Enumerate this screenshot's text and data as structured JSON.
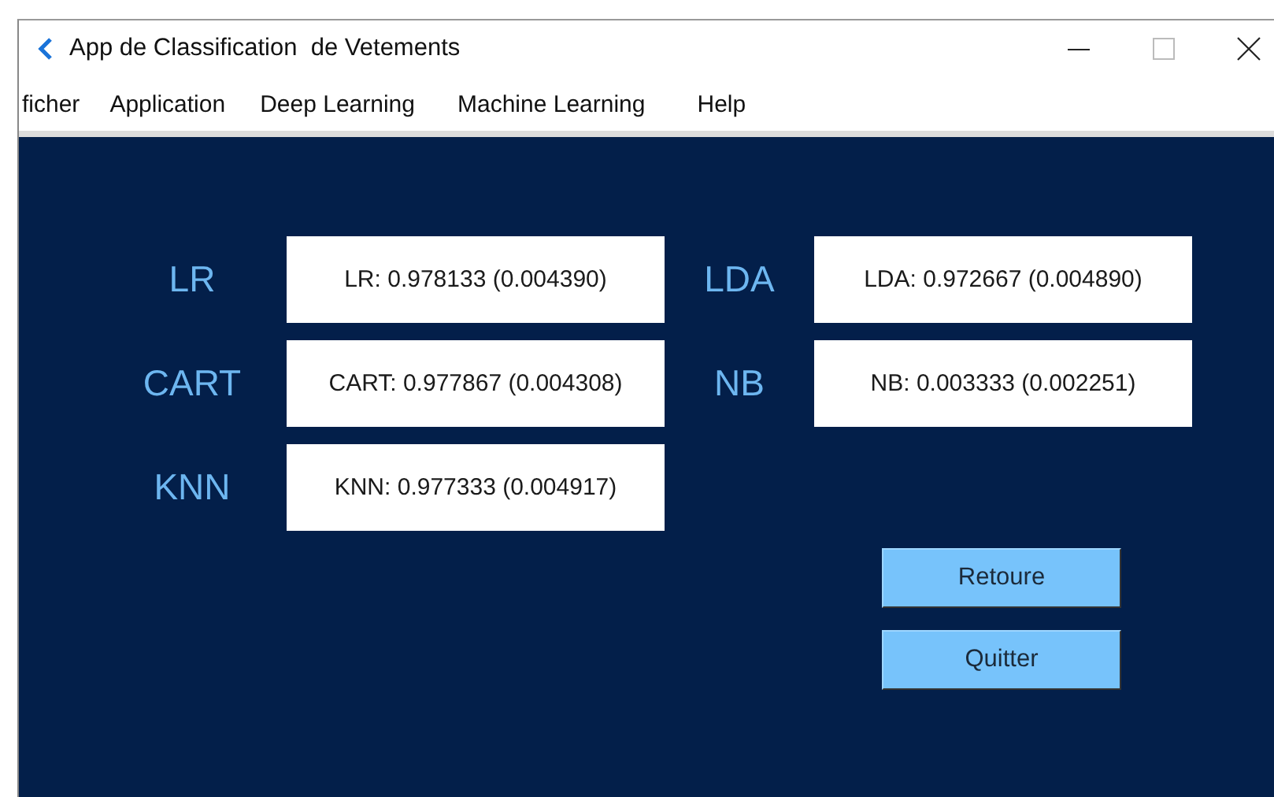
{
  "window": {
    "title": "App de Classification  de Vetements"
  },
  "menu": [
    "ficher",
    "Application",
    "Deep Learning",
    "Machine Learning",
    "Help"
  ],
  "result_columns": [
    [
      {
        "label": "LR",
        "result": "LR: 0.978133 (0.004390)"
      },
      {
        "label": "CART",
        "result": "CART: 0.977867 (0.004308)"
      },
      {
        "label": "KNN",
        "result": "KNN: 0.977333 (0.004917)"
      }
    ],
    [
      {
        "label": "LDA",
        "result": "LDA: 0.972667 (0.004890)"
      },
      {
        "label": "NB",
        "result": "NB: 0.003333 (0.002251)"
      }
    ]
  ],
  "buttons": [
    "Retoure",
    "Quitter"
  ]
}
